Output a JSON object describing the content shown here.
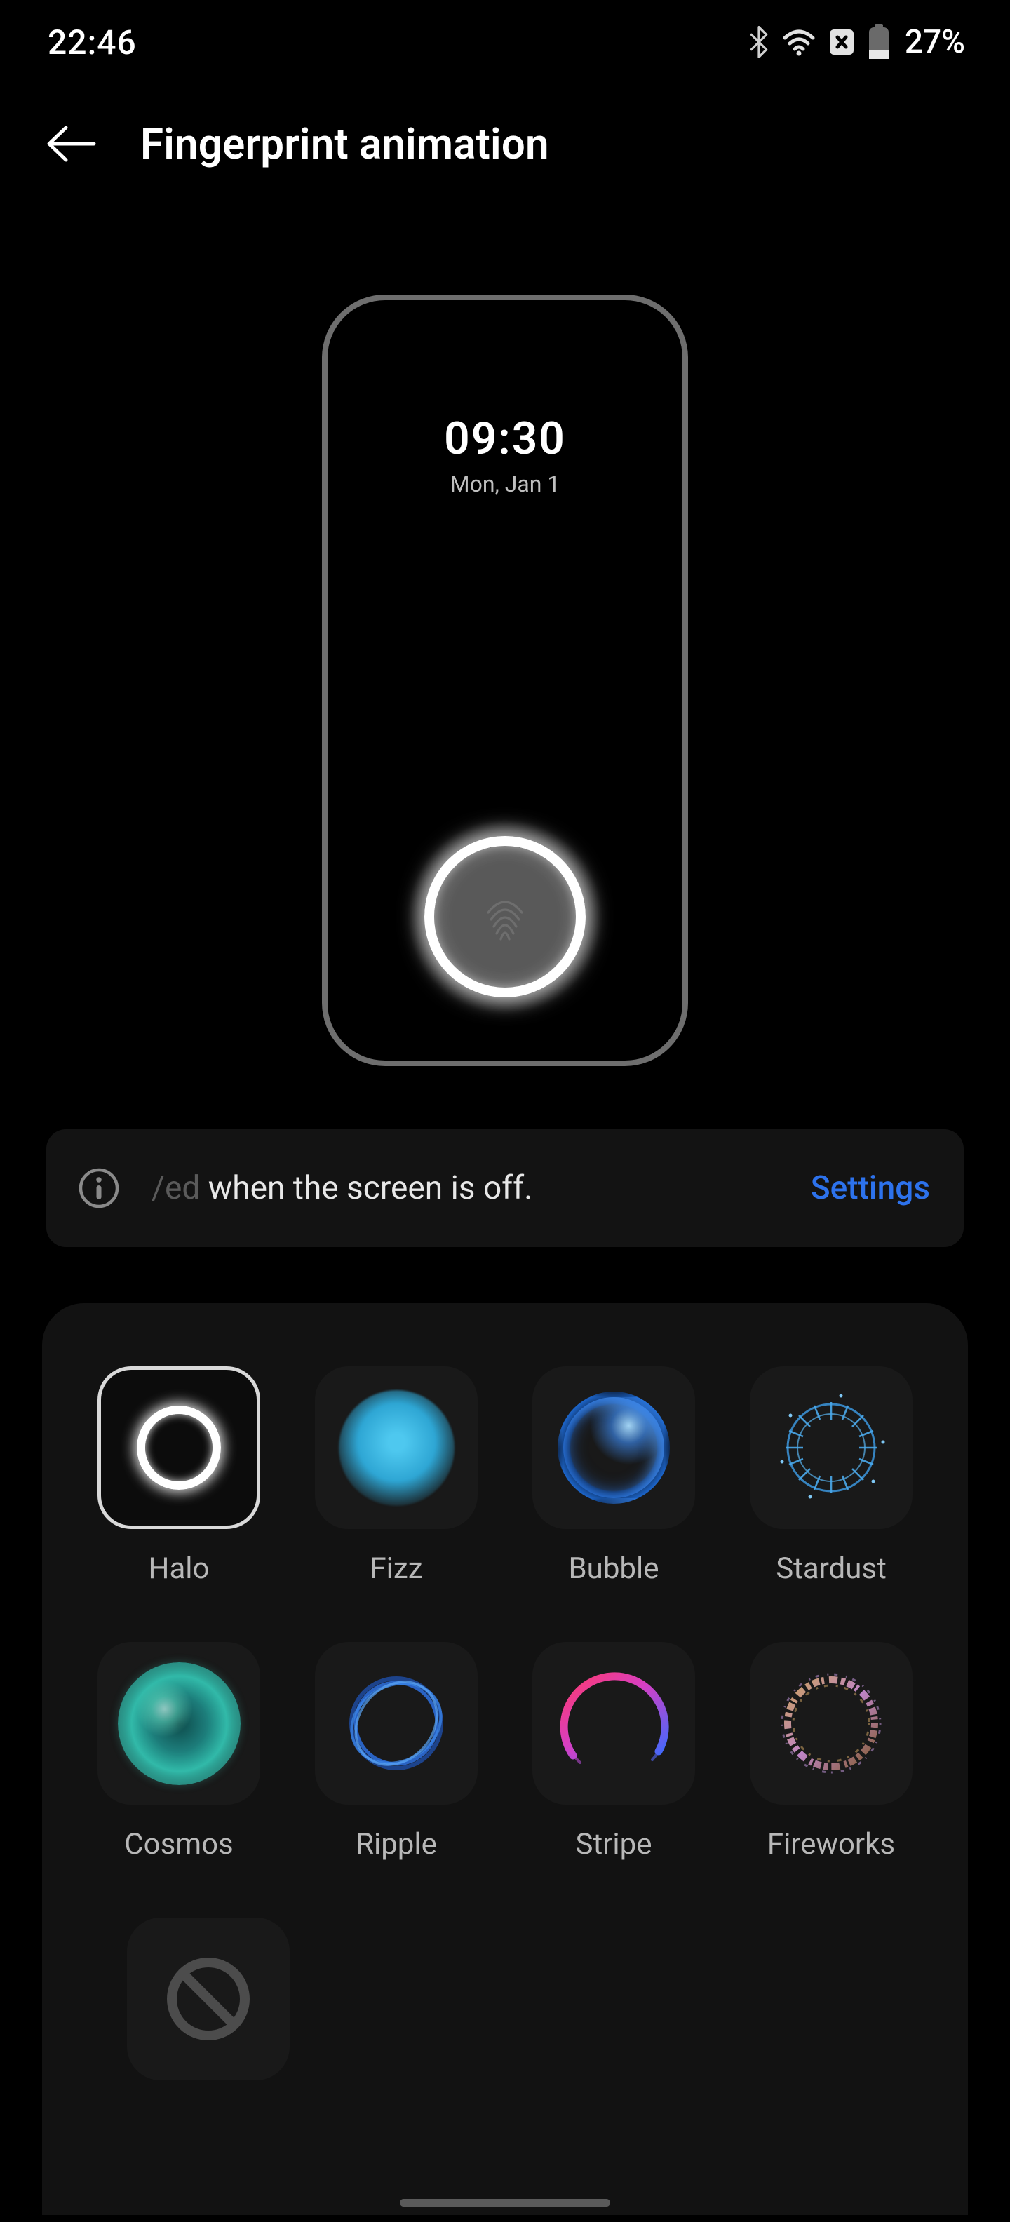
{
  "status": {
    "time": "22:46",
    "battery_pct": "27%",
    "icons": [
      "bluetooth",
      "wifi",
      "sim-error",
      "battery"
    ]
  },
  "header": {
    "title": "Fingerprint animation"
  },
  "preview": {
    "time": "09:30",
    "date": "Mon, Jan 1"
  },
  "info": {
    "text_partial": "/ed",
    "text_main": " when the screen is off.",
    "settings_label": "Settings"
  },
  "grid": {
    "selected_index": 0,
    "items": [
      {
        "label": "Halo",
        "id": "halo"
      },
      {
        "label": "Fizz",
        "id": "fizz"
      },
      {
        "label": "Bubble",
        "id": "bubble"
      },
      {
        "label": "Stardust",
        "id": "stardust"
      },
      {
        "label": "Cosmos",
        "id": "cosmos"
      },
      {
        "label": "Ripple",
        "id": "ripple"
      },
      {
        "label": "Stripe",
        "id": "stripe"
      },
      {
        "label": "Fireworks",
        "id": "fireworks"
      },
      {
        "label": "",
        "id": "none"
      }
    ]
  },
  "colors": {
    "link": "#2d72ec"
  }
}
